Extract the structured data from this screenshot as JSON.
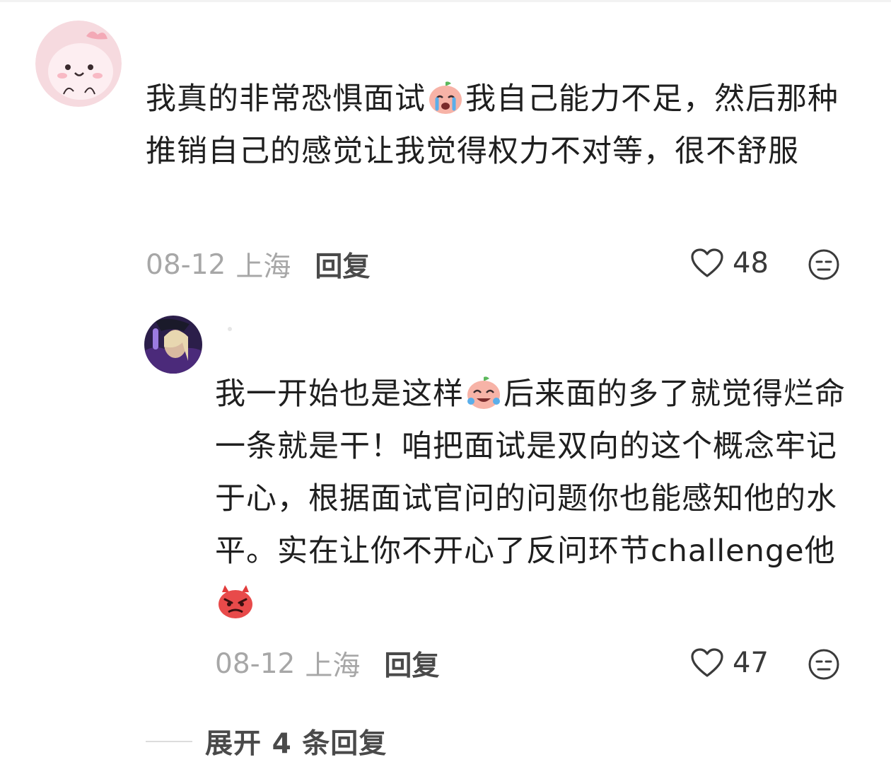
{
  "comments": [
    {
      "avatar_icon": "pink-cartoon-avatar",
      "text_a": "我真的非常恐惧面试",
      "emoji_a": "crying-peach-emoji",
      "text_b": "我自己能力不足，然后那种推销自己的感觉让我觉得权力不对等，很不舒服",
      "date": "08-12",
      "location": "上海",
      "reply_label": "回复",
      "like_icon": "heart-outline-icon",
      "likes": "48",
      "react_icon": "meh-face-icon"
    },
    {
      "avatar_icon": "photo-avatar",
      "text_a": "我一开始也是这样",
      "emoji_a": "laughing-peach-emoji",
      "text_b": "后来面的多了就觉得烂命一条就是干！咱把面试是双向的这个概念牢记于心，根据面试官问的问题你也能感知他的水平。实在让你不开心了反问环节challenge他",
      "emoji_b": "angry-devil-emoji",
      "date": "08-12",
      "location": "上海",
      "reply_label": "回复",
      "like_icon": "heart-outline-icon",
      "likes": "47",
      "react_icon": "meh-face-icon"
    }
  ],
  "expand_replies": {
    "label": "展开 4 条回复"
  },
  "colors": {
    "text": "#1f1f1f",
    "meta": "#a7a7a7",
    "reply": "#4a4a4a",
    "avatar_pink": "#f6dadf"
  }
}
